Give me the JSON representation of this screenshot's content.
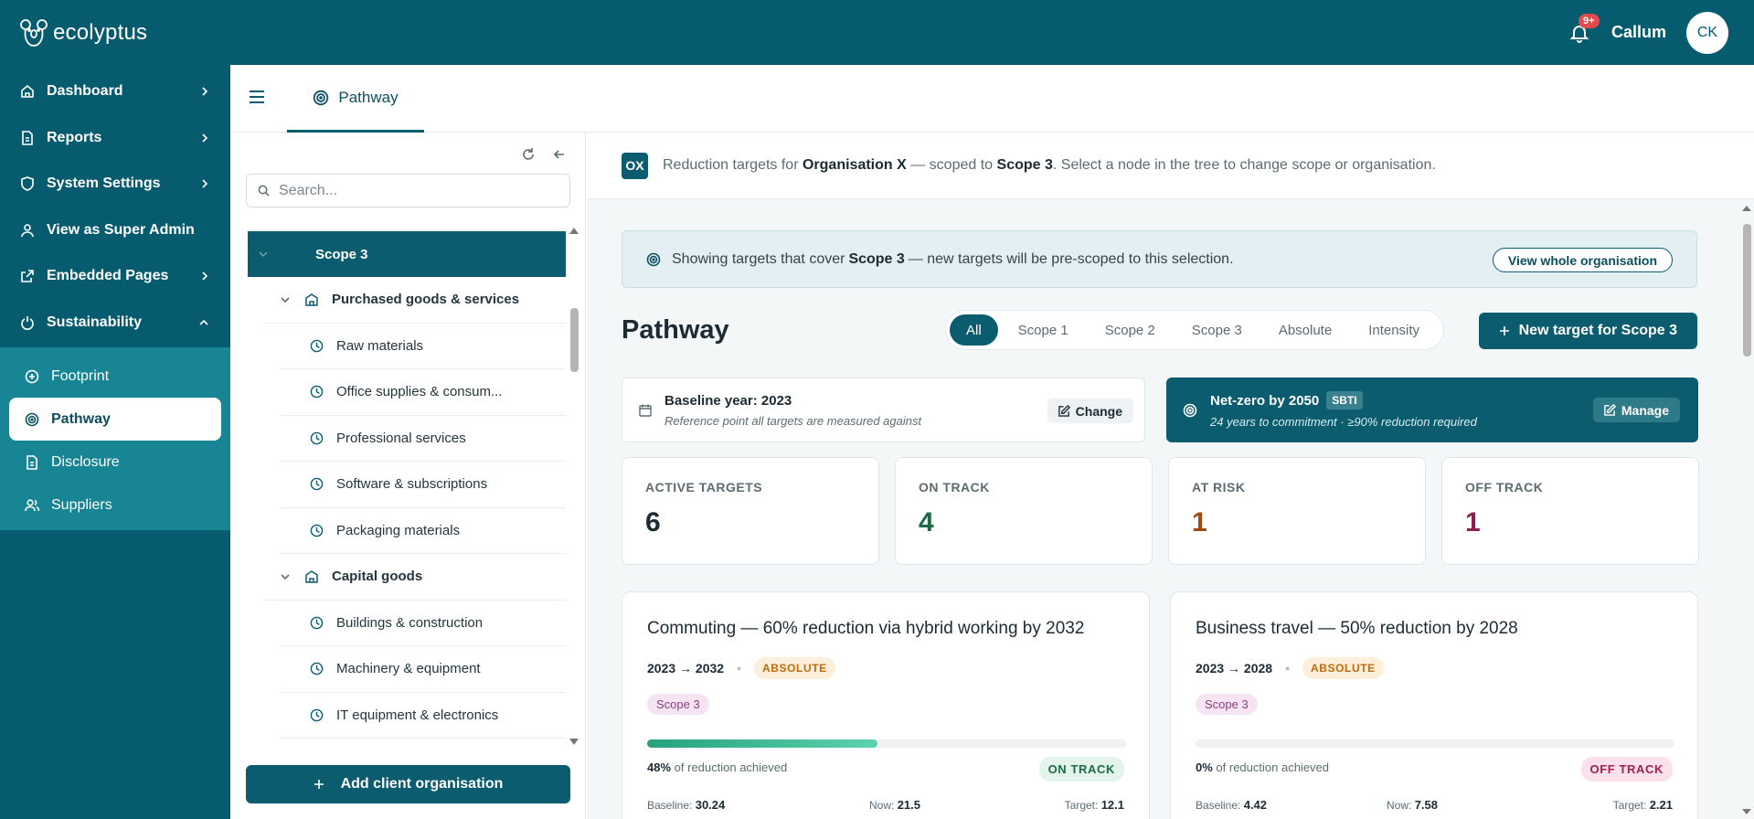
{
  "brand": {
    "name": "ecolyptus"
  },
  "topbar": {
    "notifications_badge": "9+",
    "user_name": "Callum",
    "avatar_initials": "CK"
  },
  "sidebar": {
    "items": [
      {
        "label": "Dashboard",
        "icon": "home-icon"
      },
      {
        "label": "Reports",
        "icon": "document-icon"
      },
      {
        "label": "System Settings",
        "icon": "shield-icon"
      },
      {
        "label": "View as Super Admin",
        "icon": "user-icon"
      },
      {
        "label": "Embedded Pages",
        "icon": "external-link-icon"
      },
      {
        "label": "Sustainability",
        "icon": "power-icon"
      }
    ],
    "sub_items": [
      {
        "label": "Footprint",
        "icon": "plus-circle-icon"
      },
      {
        "label": "Pathway",
        "icon": "target-icon",
        "active": true
      },
      {
        "label": "Disclosure",
        "icon": "document-icon"
      },
      {
        "label": "Suppliers",
        "icon": "users-icon"
      }
    ]
  },
  "tabs": {
    "active": "Pathway"
  },
  "tree": {
    "search_placeholder": "Search...",
    "selected": "Scope 3",
    "groups": [
      {
        "label": "Purchased goods & services",
        "children": [
          "Raw materials",
          "Office supplies & consum...",
          "Professional services",
          "Software & subscriptions",
          "Packaging materials"
        ]
      },
      {
        "label": "Capital goods",
        "children": [
          "Buildings & construction",
          "Machinery & equipment",
          "IT equipment & electronics"
        ]
      }
    ],
    "add_button": "Add client organisation"
  },
  "context": {
    "badge": "OX",
    "prefix": "Reduction targets for",
    "org": "Organisation X",
    "mid": "— scoped to",
    "scope": "Scope 3",
    "suffix": ". Select a node in the tree to change scope or organisation."
  },
  "scope_note": {
    "prefix": "Showing targets that cover",
    "scope": "Scope 3",
    "suffix": "— new targets will be pre-scoped to this selection.",
    "button": "View whole organisation"
  },
  "page": {
    "title": "Pathway",
    "filters": [
      "All",
      "Scope 1",
      "Scope 2",
      "Scope 3",
      "Absolute",
      "Intensity"
    ],
    "active_filter": "All",
    "new_target_label": "New target for Scope 3"
  },
  "baseline": {
    "title": "Baseline year: 2023",
    "subtitle": "Reference point all targets are measured against",
    "button": "Change"
  },
  "netzero": {
    "title": "Net-zero by 2050",
    "badge": "SBTI",
    "subtitle": "24 years to commitment · ≥90% reduction required",
    "button": "Manage"
  },
  "stats": [
    {
      "label": "ACTIVE TARGETS",
      "value": "6",
      "color": "#1c2b33"
    },
    {
      "label": "ON TRACK",
      "value": "4",
      "color": "#1d6b45"
    },
    {
      "label": "AT RISK",
      "value": "1",
      "color": "#a04a10"
    },
    {
      "label": "OFF TRACK",
      "value": "1",
      "color": "#8b1f4f"
    }
  ],
  "targets": [
    {
      "title": "Commuting — 60% reduction via hybrid working by 2032",
      "years": "2023 → 2032",
      "type": "ABSOLUTE",
      "scope": "Scope 3",
      "progress_pct": 48,
      "progress_label": "48%",
      "achieved_suffix": "of reduction achieved",
      "status": "ON TRACK",
      "baseline_label": "Baseline:",
      "baseline": "30.24",
      "now_label": "Now:",
      "now": "21.5",
      "target_label": "Target:",
      "target": "12.1"
    },
    {
      "title": "Business travel — 50% reduction by 2028",
      "years": "2023 → 2028",
      "type": "ABSOLUTE",
      "scope": "Scope 3",
      "progress_pct": 0,
      "progress_label": "0%",
      "achieved_suffix": "of reduction achieved",
      "status": "OFF TRACK",
      "baseline_label": "Baseline:",
      "baseline": "4.42",
      "now_label": "Now:",
      "now": "7.58",
      "target_label": "Target:",
      "target": "2.21"
    }
  ]
}
